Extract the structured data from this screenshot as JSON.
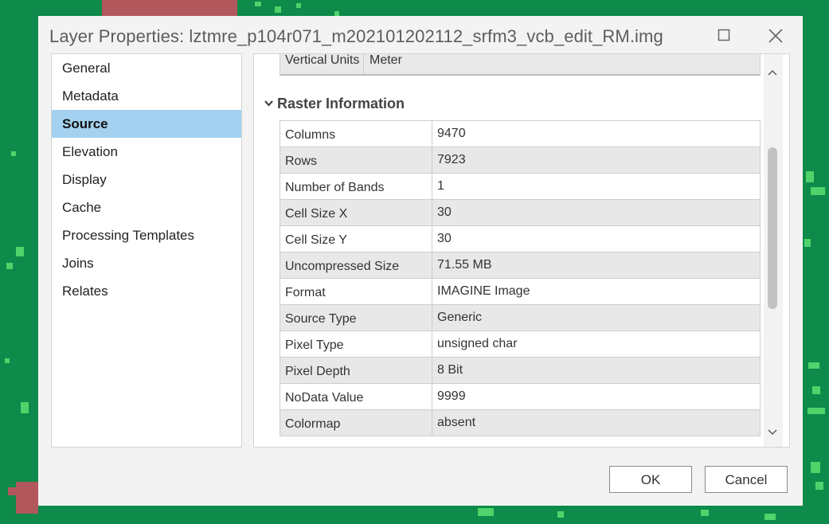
{
  "window": {
    "title": "Layer Properties: lztmre_p104r071_m202101202112_srfm3_vcb_edit_RM.img",
    "maximize_icon": "maximize-icon",
    "close_icon": "close-icon"
  },
  "nav": {
    "items": [
      {
        "label": "General"
      },
      {
        "label": "Metadata"
      },
      {
        "label": "Source",
        "active": true
      },
      {
        "label": "Elevation"
      },
      {
        "label": "Display"
      },
      {
        "label": "Cache"
      },
      {
        "label": "Processing Templates"
      },
      {
        "label": "Joins"
      },
      {
        "label": "Relates"
      }
    ]
  },
  "content": {
    "previous_row": {
      "key": "Vertical Units",
      "value": "Meter"
    },
    "section_title": "Raster Information",
    "rows": [
      {
        "key": "Columns",
        "value": "9470"
      },
      {
        "key": "Rows",
        "value": "7923"
      },
      {
        "key": "Number of Bands",
        "value": "1"
      },
      {
        "key": "Cell Size X",
        "value": "30"
      },
      {
        "key": "Cell Size Y",
        "value": "30"
      },
      {
        "key": "Uncompressed Size",
        "value": "71.55 MB"
      },
      {
        "key": "Format",
        "value": "IMAGINE Image"
      },
      {
        "key": "Source Type",
        "value": "Generic"
      },
      {
        "key": "Pixel Type",
        "value": "unsigned char"
      },
      {
        "key": "Pixel Depth",
        "value": "8 Bit"
      },
      {
        "key": "NoData Value",
        "value": "9999"
      },
      {
        "key": "Colormap",
        "value": "absent"
      }
    ]
  },
  "buttons": {
    "ok": "OK",
    "cancel": "Cancel"
  },
  "colors": {
    "background": "#0e8a4a",
    "selection": "#a4d1ef",
    "red_patch": "#b2575c",
    "green_speck": "#4fd36a"
  }
}
